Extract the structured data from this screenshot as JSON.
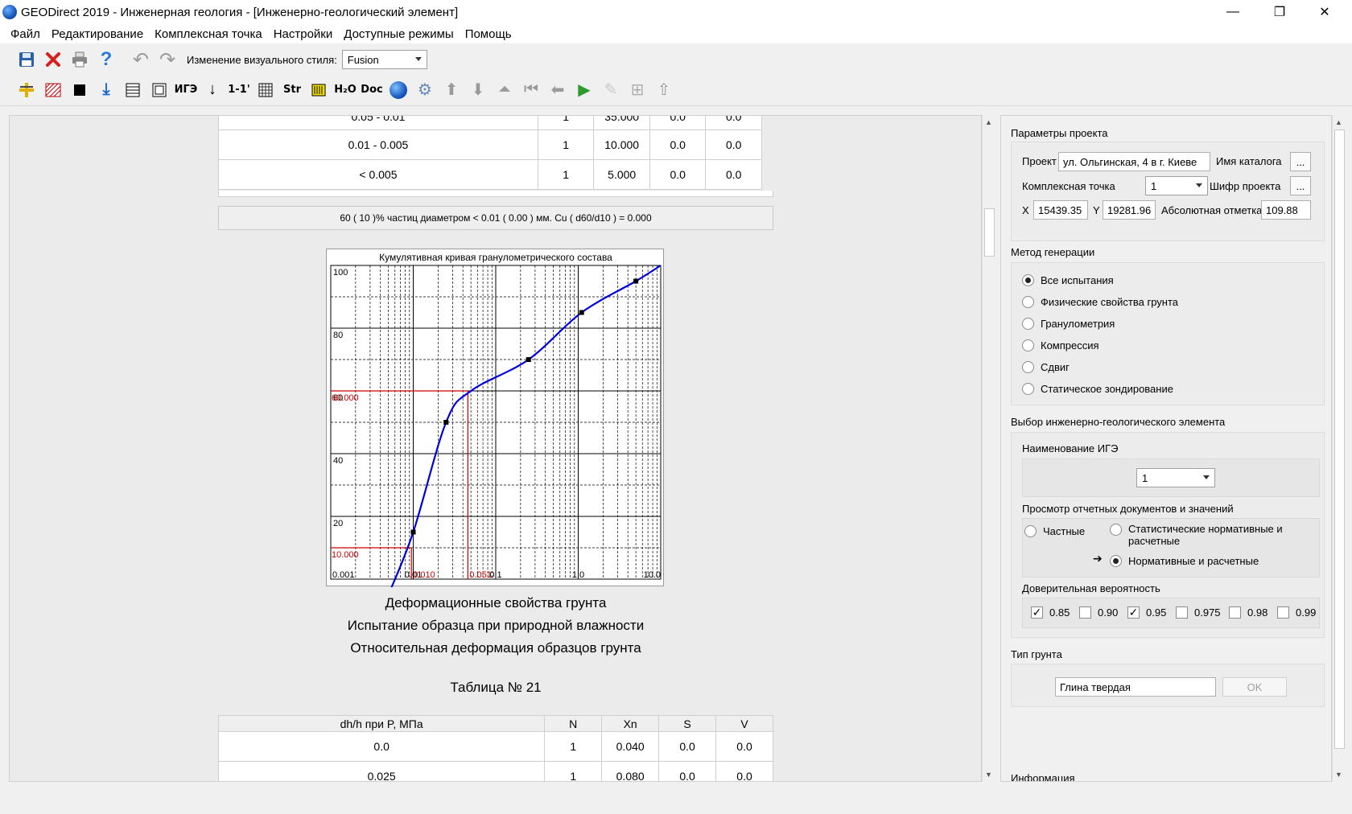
{
  "window": {
    "title": "GEODirect 2019 - Инженерная геология - [Инженерно-геологический элемент]",
    "minimize": "—",
    "maximize": "❐",
    "close": "✕"
  },
  "menu": [
    "Файл",
    "Редактирование",
    "Комплексная точка",
    "Настройки",
    "Доступные режимы",
    "Помощь"
  ],
  "toolbar1": {
    "style_label": "Изменение визуального стиля:",
    "style_value": "Fusion"
  },
  "toolbar2": {
    "igz_label": "ИГЭ",
    "section_label": "1-1'",
    "str_label": "Str",
    "h2o_label": "H₂O",
    "doc_label": "Doc"
  },
  "top_table": {
    "rows": [
      {
        "range": "0.05 - 0.01",
        "n": "1",
        "xn": "35.000",
        "s": "0.0",
        "v": "0.0"
      },
      {
        "range": "0.01 - 0.005",
        "n": "1",
        "xn": "10.000",
        "s": "0.0",
        "v": "0.0"
      },
      {
        "range": "< 0.005",
        "n": "1",
        "xn": "5.000",
        "s": "0.0",
        "v": "0.0"
      }
    ]
  },
  "note": "60 ( 10 )% частиц диаметром  < 0.01 ( 0.00 ) мм. Cu ( d60/d10 ) = 0.000",
  "chart_data": {
    "type": "line",
    "title": "Кумулятивная кривая гранулометрического состава",
    "x_scale": "log",
    "xlim": [
      0.001,
      10.0
    ],
    "ylim": [
      0,
      100
    ],
    "x_tick_labels": [
      "0.001",
      "0.01",
      "0.1",
      "1.0",
      "10.0"
    ],
    "y_tick_labels": [
      "20",
      "40",
      "60",
      "80",
      "100"
    ],
    "series": [
      {
        "x": [
          0.005,
          0.01,
          0.025,
          0.05,
          0.25,
          1.1,
          5.0,
          10.0
        ],
        "values": [
          -5,
          15,
          50,
          60,
          70,
          85,
          95,
          100
        ],
        "color": "#0000dd"
      }
    ],
    "markers": {
      "x": [
        0.01,
        0.025,
        0.25,
        1.1,
        5.0
      ],
      "values": [
        15,
        50,
        70,
        85,
        95
      ]
    },
    "annotations": {
      "d60_label": "60.000",
      "d10_label": "10.000",
      "d10_x_label": "0.010",
      "d60_x_label": "0.051",
      "d60_x": 0.046,
      "d10_x": 0.0095,
      "color": "#cc0000"
    }
  },
  "headings": {
    "h1": "Деформационные свойства грунта",
    "h2": "Испытание образца при природной влажности",
    "h3": "Относительная деформация образцов грунта",
    "table_no": "Таблица № 21"
  },
  "def_table": {
    "headers": [
      "dh/h при P, МПа",
      "N",
      "Xn",
      "S",
      "V"
    ],
    "rows": [
      {
        "p": "0.0",
        "n": "1",
        "xn": "0.040",
        "s": "0.0",
        "v": "0.0"
      },
      {
        "p": "0.025",
        "n": "1",
        "xn": "0.080",
        "s": "0.0",
        "v": "0.0"
      }
    ]
  },
  "right_panel": {
    "project_params": {
      "title": "Параметры проекта",
      "project_label": "Проект",
      "project_value": "ул. Ольгинская, 4 в г. Киеве",
      "catalog_label": "Имя каталога",
      "dots": "...",
      "point_label": "Комплексная точка",
      "point_value": "1",
      "code_label": "Шифр проекта",
      "x_label": "X",
      "x_value": "15439.35",
      "y_label": "Y",
      "y_value": "19281.96",
      "abs_label": "Абсолютная отметка",
      "abs_value": "109.88"
    },
    "gen_method": {
      "title": "Метод генерации",
      "options": [
        "Все испытания",
        "Физические свойства грунта",
        "Гранулометрия",
        "Компрессия",
        "Сдвиг",
        "Статическое зондирование"
      ],
      "selected": 0
    },
    "ige_select": {
      "title": "Выбор инженерно-геологического элемента",
      "name_label": "Наименование ИГЭ",
      "name_value": "1",
      "view_label": "Просмотр отчетных документов и значений",
      "opt_partial": "Частные",
      "opt_stat": "Статистические нормативные и расчетные",
      "opt_norm": "Нормативные и расчетные",
      "arrow": "➔",
      "conf_label": "Доверительная вероятность",
      "conf": [
        {
          "label": "0.85",
          "checked": true
        },
        {
          "label": "0.90",
          "checked": false
        },
        {
          "label": "0.95",
          "checked": true
        },
        {
          "label": "0.975",
          "checked": false
        },
        {
          "label": "0.98",
          "checked": false
        },
        {
          "label": "0.99",
          "checked": false
        }
      ]
    },
    "soil_type": {
      "title": "Тип грунта",
      "value": "Глина твердая",
      "ok": "OK"
    },
    "info_title": "Информация"
  }
}
